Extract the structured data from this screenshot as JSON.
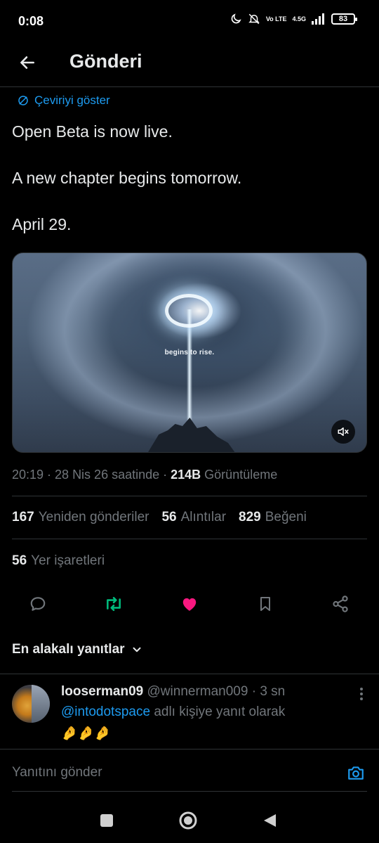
{
  "status_bar": {
    "time": "0:08",
    "network": "4.5G",
    "volte": "Vo LTE",
    "battery": "83"
  },
  "header": {
    "title": "Gönderi"
  },
  "post": {
    "translate_label": "Çeviriyi göster",
    "paragraphs": [
      "Open Beta is now live.",
      "A new chapter begins tomorrow.",
      "April 29."
    ],
    "media_caption": "begins to rise.",
    "meta_time": "20:19 · 28 Nis 26 saatinde · ",
    "views_count": "214B",
    "views_label": " Görüntüleme"
  },
  "stats": {
    "reposts_count": "167",
    "reposts_label": "Yeniden gönderiler",
    "quotes_count": "56",
    "quotes_label": "Alıntılar",
    "likes_count": "829",
    "likes_label": "Beğeni",
    "bookmarks_count": "56",
    "bookmarks_label": "Yer işaretleri"
  },
  "actions": {
    "icons": [
      "reply-icon",
      "repost-icon",
      "like-icon",
      "bookmark-icon",
      "share-icon"
    ],
    "repost_color": "#00ba7c",
    "like_color": "#f91880"
  },
  "replies": {
    "sort_label": "En alakalı yanıtlar",
    "items": [
      {
        "name": "looserman09",
        "handle": "@winnerman009 · 3 sn",
        "mention": "@intodotspace",
        "context_suffix": " adlı kişiye yanıt olarak",
        "body": "🤌🤌🤌"
      }
    ]
  },
  "compose": {
    "placeholder": "Yanıtını gönder"
  },
  "colors": {
    "accent": "#1d9bf0",
    "muted": "#71767b",
    "text": "#e7e9ea",
    "border": "#2f3336"
  }
}
